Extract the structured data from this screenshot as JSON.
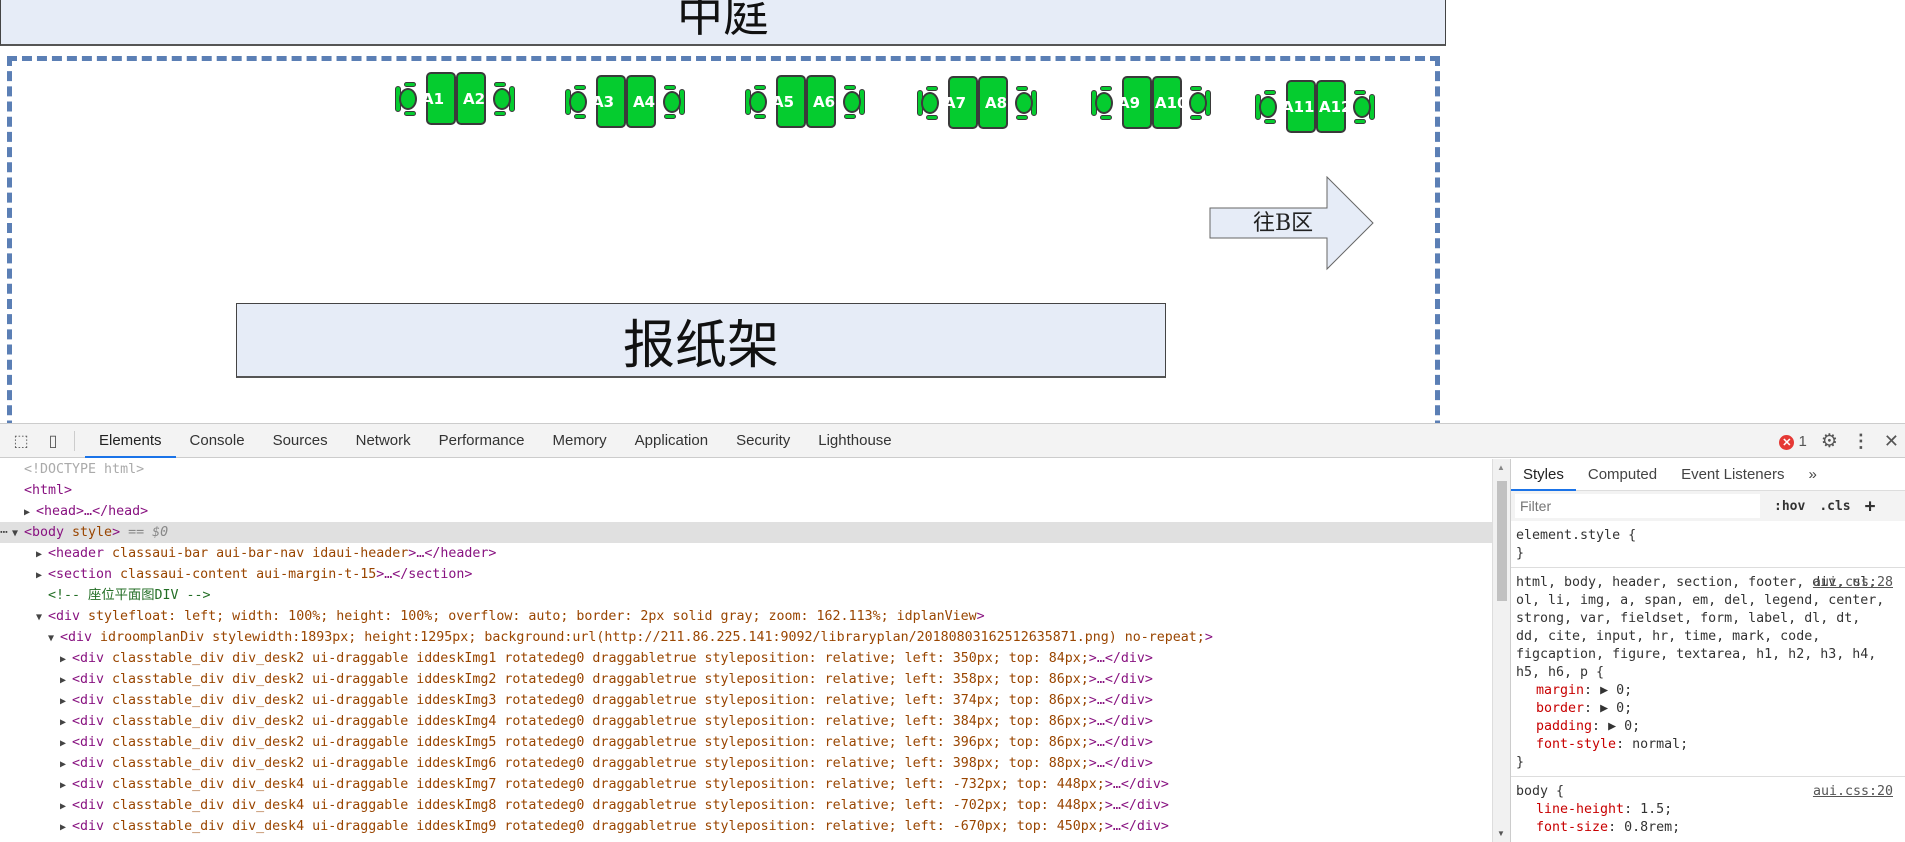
{
  "floorplan": {
    "courtyard_label": "中庭",
    "rack_label": "报纸架",
    "arrow_label": "往B区",
    "seat_color": "#05cc2f",
    "zone_border_color": "#5b7fb5",
    "groups": [
      {
        "left": "A1",
        "right": "A2"
      },
      {
        "left": "A3",
        "right": "A4"
      },
      {
        "left": "A5",
        "right": "A6"
      },
      {
        "left": "A7",
        "right": "A8"
      },
      {
        "left": "A9",
        "right": "A10"
      },
      {
        "left": "A11",
        "right": "A12"
      }
    ]
  },
  "devtools": {
    "tabs": [
      "Elements",
      "Console",
      "Sources",
      "Network",
      "Performance",
      "Memory",
      "Application",
      "Security",
      "Lighthouse"
    ],
    "active_tab": "Elements",
    "error_count": "1",
    "dom_lines": [
      "<!DOCTYPE html>",
      "<html>",
      "<head>…</head>",
      "<body style> == $0",
      "<header class=\"aui-bar aui-bar-nav\" id=\"aui-header\">…</header>",
      "<section class=\"aui-content aui-margin-t-15\">…</section>",
      "<!-- 座位平面图DIV -->",
      "<div style=\"float: left; width: 100%; height: 100%; overflow: auto; border: 2px solid gray; zoom: 162.113%;\" id=\"planView\">",
      "<div id=\"roomplanDiv\" style=\"width:1893px; height:1295px; background:url(http://211.86.225.141:9092/libraryplan/20180803162512635871.png) no-repeat;\">",
      "<div class=\"table_div div_desk2 ui-draggable\" id=\"deskImg1\" rotatedeg=\"0\" draggable=\"true\" style=\"position: relative; left: 350px; top: 84px;\">…</div>",
      "<div class=\"table_div div_desk2 ui-draggable\" id=\"deskImg2\" rotatedeg=\"0\" draggable=\"true\" style=\"position: relative; left: 358px; top: 86px;\">…</div>",
      "<div class=\"table_div div_desk2 ui-draggable\" id=\"deskImg3\" rotatedeg=\"0\" draggable=\"true\" style=\"position: relative; left: 374px; top: 86px;\">…</div>",
      "<div class=\"table_div div_desk2 ui-draggable\" id=\"deskImg4\" rotatedeg=\"0\" draggable=\"true\" style=\"position: relative; left: 384px; top: 86px;\">…</div>",
      "<div class=\"table_div div_desk2 ui-draggable\" id=\"deskImg5\" rotatedeg=\"0\" draggable=\"true\" style=\"position: relative; left: 396px; top: 86px;\">…</div>",
      "<div class=\"table_div div_desk2 ui-draggable\" id=\"deskImg6\" rotatedeg=\"0\" draggable=\"true\" style=\"position: relative; left: 398px; top: 88px;\">…</div>",
      "<div class=\"table_div div_desk4 ui-draggable\" id=\"deskImg7\" rotatedeg=\"0\" draggable=\"true\" style=\"position: relative; left: -732px; top: 448px;\">…</div>",
      "<div class=\"table_div div_desk4 ui-draggable\" id=\"deskImg8\" rotatedeg=\"0\" draggable=\"true\" style=\"position: relative; left: -702px; top: 448px;\">…</div>",
      "<div class=\"table_div div_desk4 ui-draggable\" id=\"deskImg9\" rotatedeg=\"0\" draggable=\"true\" style=\"position: relative; left: -670px; top: 450px;\">…</div>"
    ],
    "styles": {
      "tabs": [
        "Styles",
        "Computed",
        "Event Listeners",
        "»"
      ],
      "filter_placeholder": "Filter",
      "hov": ":hov",
      "cls": ".cls",
      "add": "+",
      "element_style_open": "element.style {",
      "close_brace": "}",
      "rule1_selector": "html, body, header, section, footer, div, ul, ol, li, img, a, span, em, del, legend, center, strong, var, fieldset, form, label, dl, dt, dd, cite, input, hr, time, mark, code, figcaption, figure, textarea, h1, h2, h3, h4, h5, h6, p {",
      "rule1_source": "aui.css:28",
      "rule1_props": [
        {
          "name": "margin",
          "value": "▶ 0;"
        },
        {
          "name": "border",
          "value": "▶ 0;"
        },
        {
          "name": "padding",
          "value": "▶ 0;"
        },
        {
          "name": "font-style",
          "value": "normal;"
        }
      ],
      "rule2_selector": "body {",
      "rule2_source": "aui.css:20",
      "rule2_props": [
        {
          "name": "line-height",
          "value": "1.5;"
        },
        {
          "name": "font-size",
          "value": "0.8rem;"
        }
      ]
    }
  }
}
